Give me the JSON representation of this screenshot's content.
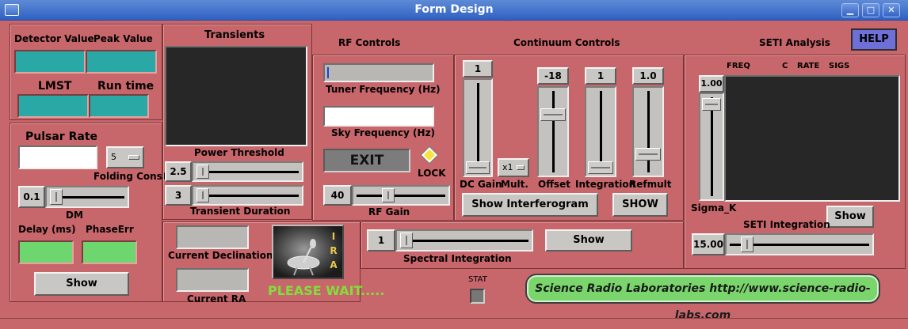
{
  "window": {
    "title": "Form Design"
  },
  "help_label": "HELP",
  "left": {
    "detector_value_label": "Detector Value",
    "peak_value_label": "Peak Value",
    "lmst_label": "LMST",
    "run_time_label": "Run time",
    "pulsar_rate_label": "Pulsar Rate",
    "folding_const_label": "Folding Const",
    "folding_const_value": "5",
    "dm_value": "0.1",
    "dm_label": "DM",
    "delay_label": "Delay (ms)",
    "phase_err_label": "PhaseErr",
    "show_label": "Show"
  },
  "transients": {
    "title": "Transients",
    "power_threshold_label": "Power Threshold",
    "power_threshold_value": "2.5",
    "transient_duration_value": "3",
    "transient_duration_label": "Transient Duration"
  },
  "position": {
    "current_declination_label": "Current Declination",
    "current_ra_label": "Current RA",
    "please_wait": "PLEASE WAIT.....",
    "logo_letters": [
      "I",
      "R",
      "A"
    ]
  },
  "rf": {
    "title": "RF Controls",
    "tuner_label": "Tuner Frequency (Hz)",
    "sky_label": "Sky Frequency (Hz)",
    "exit_label": "EXIT",
    "lock_label": "LOCK",
    "rf_gain_value": "40",
    "rf_gain_label": "RF Gain"
  },
  "continuum": {
    "title": "Continuum Controls",
    "dc_gain_value": "1",
    "mult_value": "x1",
    "offset_value": "-18",
    "integration_value": "1",
    "refmult_value": "1.0",
    "dc_gain_label": "DC Gain",
    "mult_label": "Mult.",
    "offset_label": "Offset",
    "integration_label": "Integration",
    "refmult_label": "Refmult",
    "show_interferogram_label": "Show Interferogram",
    "show_label": "SHOW",
    "spectral_integration_value": "1",
    "spectral_integration_label": "Spectral Integration",
    "spectral_show_label": "Show",
    "stat_label": "STAT"
  },
  "seti": {
    "title": "SETI Analysis",
    "col_freq": "FREQ",
    "col_c": "C",
    "col_rate": "RATE",
    "col_sigs": "SIGS",
    "sigma_value": "1.00",
    "sigma_label": "Sigma_K",
    "show_label": "Show",
    "integration_label": "SETI Integration",
    "integration_value": "15.00"
  },
  "footer": {
    "banner": "Science Radio Laboratories http://www.science-radio-labs.com"
  },
  "colors": {
    "background": "#c8676b",
    "teal": "#2aa8a6",
    "green": "#6ed66e",
    "help": "#6f6fd8",
    "please_wait": "#7fe03a"
  }
}
